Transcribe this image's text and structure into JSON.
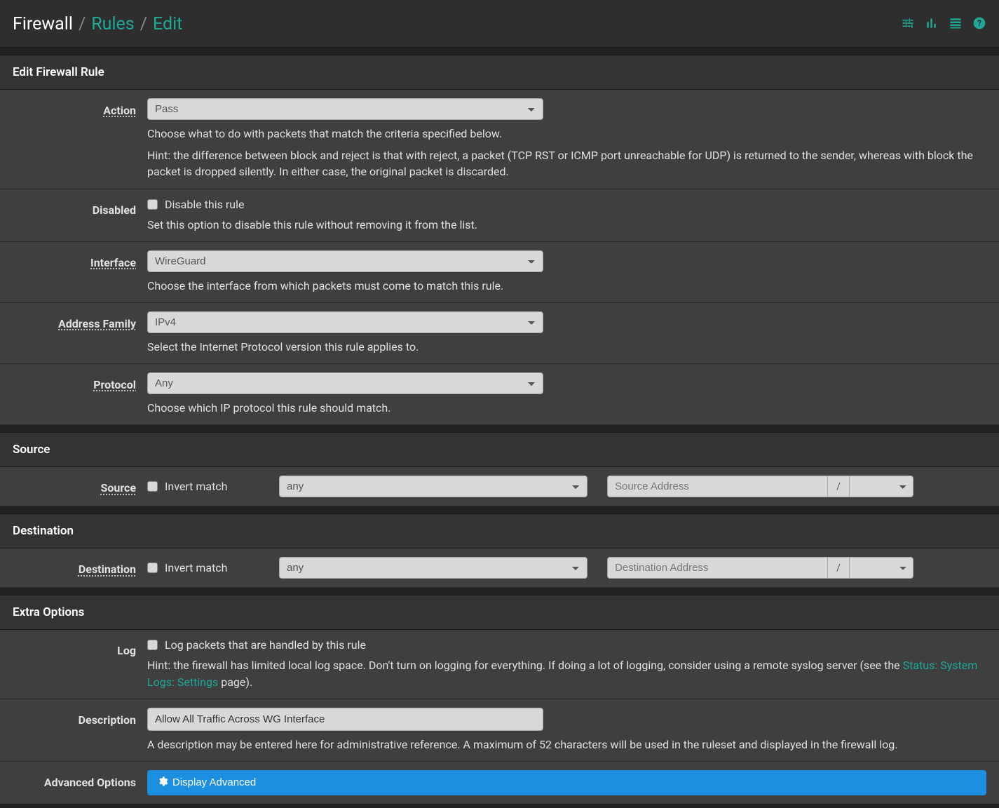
{
  "breadcrumb": {
    "root": "Firewall",
    "link": "Rules",
    "current": "Edit"
  },
  "sections": {
    "edit": "Edit Firewall Rule",
    "source": "Source",
    "destination": "Destination",
    "extra": "Extra Options"
  },
  "labels": {
    "action": "Action",
    "disabled": "Disabled",
    "interface": "Interface",
    "addressFamily": "Address Family",
    "protocol": "Protocol",
    "source": "Source",
    "destination": "Destination",
    "log": "Log",
    "description": "Description",
    "advanced": "Advanced Options"
  },
  "fields": {
    "action": {
      "value": "Pass",
      "help1": "Choose what to do with packets that match the criteria specified below.",
      "help2": "Hint: the difference between block and reject is that with reject, a packet (TCP RST or ICMP port unreachable for UDP) is returned to the sender, whereas with block the packet is dropped silently. In either case, the original packet is discarded."
    },
    "disabled": {
      "checkbox": "Disable this rule",
      "help": "Set this option to disable this rule without removing it from the list."
    },
    "interface": {
      "value": "WireGuard",
      "help": "Choose the interface from which packets must come to match this rule."
    },
    "addressFamily": {
      "value": "IPv4",
      "help": "Select the Internet Protocol version this rule applies to."
    },
    "protocol": {
      "value": "Any",
      "help": "Choose which IP protocol this rule should match."
    },
    "source": {
      "invert": "Invert match",
      "type": "any",
      "placeholder": "Source Address",
      "slash": "/"
    },
    "destination": {
      "invert": "Invert match",
      "type": "any",
      "placeholder": "Destination Address",
      "slash": "/"
    },
    "log": {
      "checkbox": "Log packets that are handled by this rule",
      "help_pre": "Hint: the firewall has limited local log space. Don't turn on logging for everything. If doing a lot of logging, consider using a remote syslog server (see the ",
      "help_link": "Status: System Logs: Settings",
      "help_post": " page)."
    },
    "description": {
      "value": "Allow All Traffic Across WG Interface",
      "help": "A description may be entered here for administrative reference. A maximum of 52 characters will be used in the ruleset and displayed in the firewall log."
    },
    "advanced": {
      "button": "Display Advanced"
    }
  }
}
